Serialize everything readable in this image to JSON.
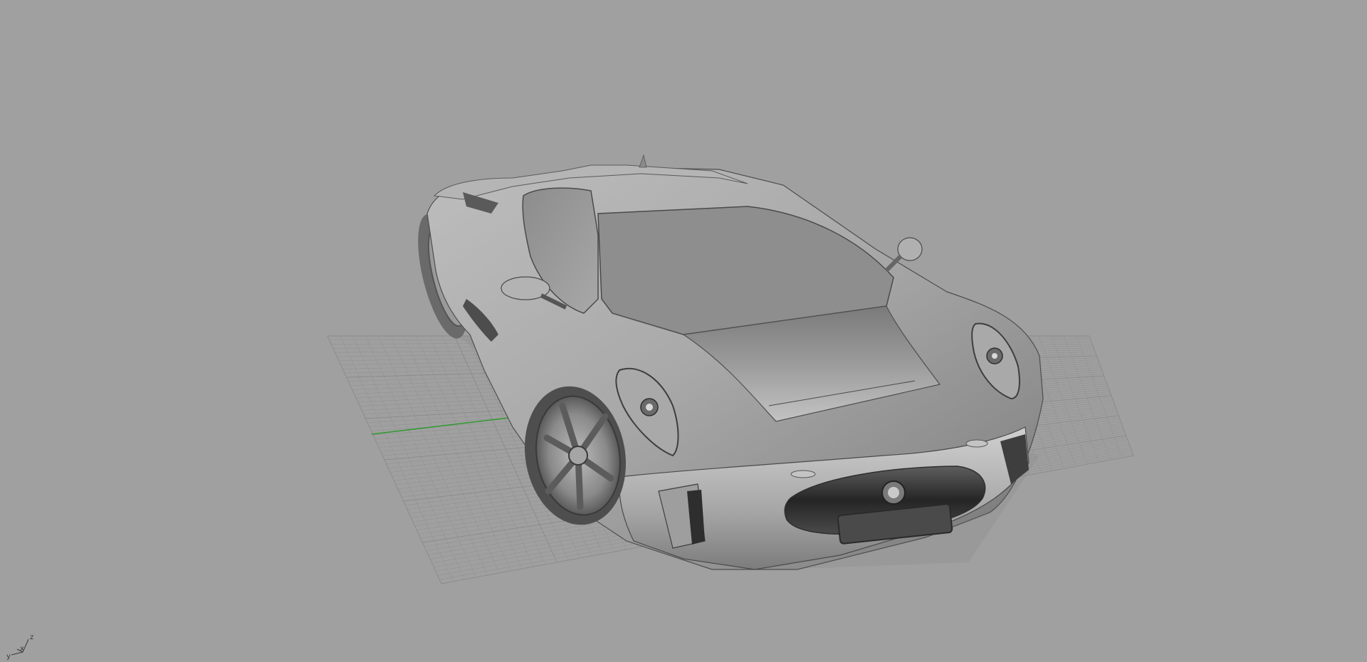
{
  "viewport": {
    "background_color": "#a0a0a0",
    "display_mode": "shaded",
    "object": "car-model"
  },
  "grid": {
    "line_color": "#8f8f8f",
    "major_line_color": "#8a8a8a",
    "x_axis_color": "#b05050",
    "y_axis_color": "#2f9a2f"
  },
  "axis_widget": {
    "x_label": "x",
    "y_label": "y",
    "z_label": "z"
  }
}
